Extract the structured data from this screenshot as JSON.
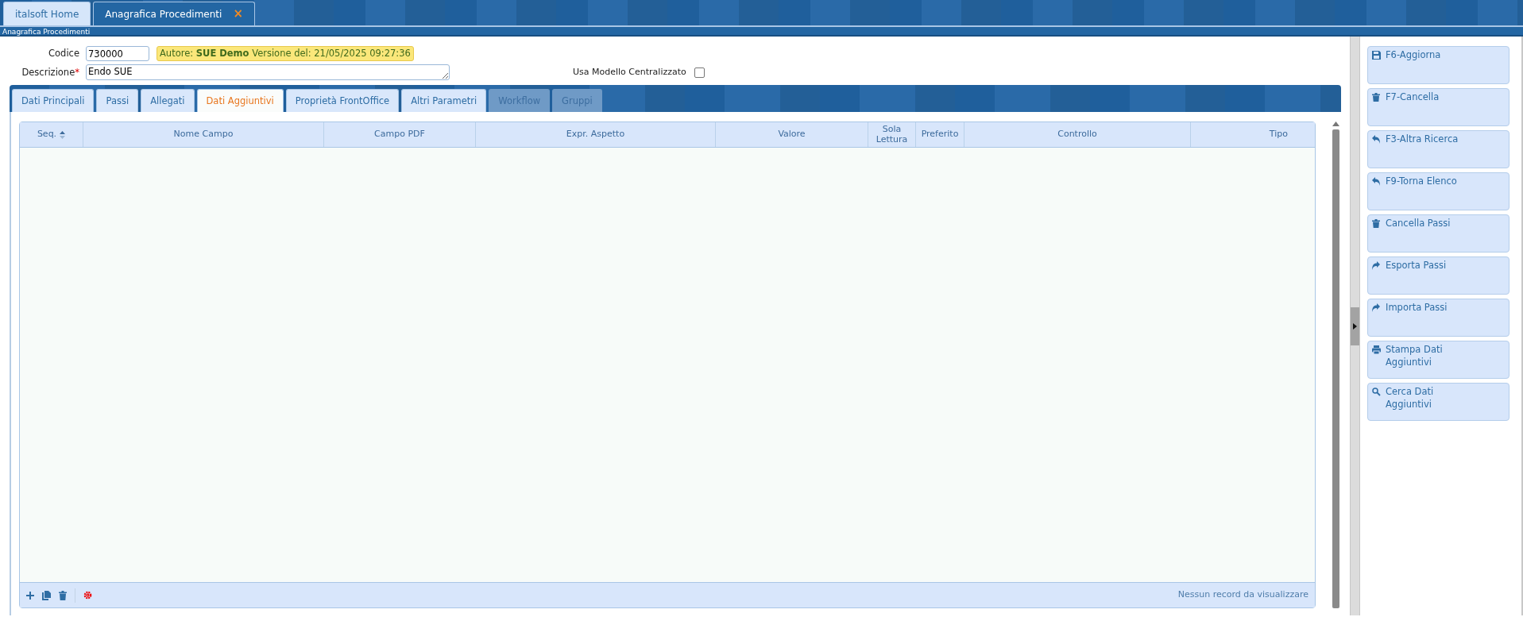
{
  "app_tabs": [
    {
      "label": "italsoft Home",
      "selected": false
    },
    {
      "label": "Anagrafica Procedimenti",
      "selected": true,
      "close_glyph": "×"
    }
  ],
  "window": {
    "title": "Anagrafica Procedimenti"
  },
  "form": {
    "codice": {
      "label": "Codice",
      "value": "730000"
    },
    "info": "Autore: **SUE Demo** Versione del: 21/05/2025 09:27:36",
    "descrizione": {
      "label": "Descrizione",
      "required_mark": "*",
      "value": "Endo SUE"
    },
    "usa_modello": {
      "label": "Usa Modello Centralizzato",
      "checked": false
    }
  },
  "tabs": [
    {
      "label": "Dati Principali",
      "selected": false,
      "disabled": false
    },
    {
      "label": "Passi",
      "selected": false,
      "disabled": false
    },
    {
      "label": "Allegati",
      "selected": false,
      "disabled": false
    },
    {
      "label": "Dati Aggiuntivi",
      "selected": true,
      "disabled": false
    },
    {
      "label": "Proprietà FrontOffice",
      "selected": false,
      "disabled": false
    },
    {
      "label": "Altri Parametri",
      "selected": false,
      "disabled": false
    },
    {
      "label": "Workflow",
      "selected": false,
      "disabled": true
    },
    {
      "label": "Gruppi",
      "selected": false,
      "disabled": true
    }
  ],
  "table": {
    "columns": [
      {
        "label": "Seq.",
        "sorted": true
      },
      {
        "label": "Nome Campo",
        "sorted": false
      },
      {
        "label": "Campo PDF",
        "sorted": false
      },
      {
        "label": "Expr. Aspetto",
        "sorted": false
      },
      {
        "label": "Valore",
        "sorted": false
      },
      {
        "label": "Sola Lettura",
        "sorted": false
      },
      {
        "label": "Preferito",
        "sorted": false
      },
      {
        "label": "Controllo",
        "sorted": false
      },
      {
        "label": "Tipo",
        "sorted": false
      }
    ],
    "footer": {
      "message": "Nessun record da visualizzare"
    }
  },
  "actions": [
    {
      "label": "F6-Aggiorna",
      "kind": "save"
    },
    {
      "label": "F7-Cancella",
      "kind": "delete"
    },
    {
      "label": "F3-Altra Ricerca",
      "kind": "back"
    },
    {
      "label": "F9-Torna Elenco",
      "kind": "back"
    },
    {
      "label": "Cancella Passi",
      "kind": "delete"
    },
    {
      "label": "Esporta Passi",
      "kind": "export"
    },
    {
      "label": "Importa Passi",
      "kind": "import"
    },
    {
      "label": "Stampa Dati Aggiuntivi",
      "kind": "print"
    },
    {
      "label": "Cerca Dati Aggiuntivi",
      "kind": "search"
    }
  ]
}
